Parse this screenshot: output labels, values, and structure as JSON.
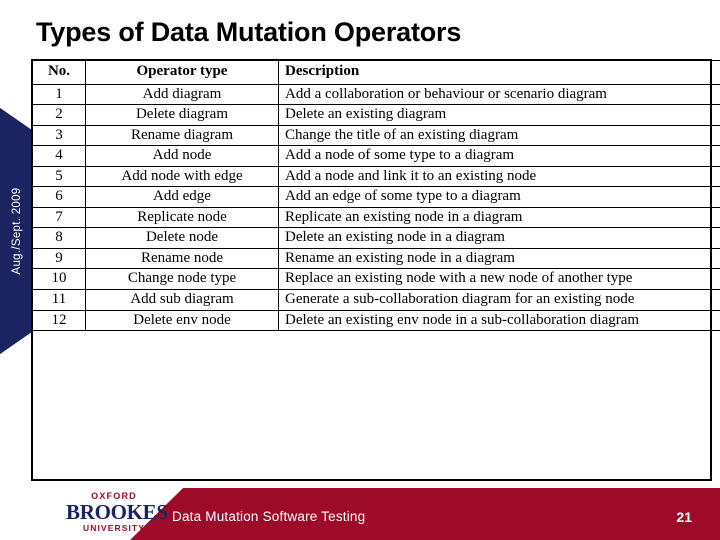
{
  "slide": {
    "title": "Types of Data Mutation Operators",
    "side_tab_label": "Aug./Sept. 2009",
    "number": "21"
  },
  "table": {
    "headers": {
      "no": "No.",
      "operator_type": "Operator type",
      "description": "Description"
    },
    "rows": [
      {
        "no": "1",
        "type": "Add diagram",
        "desc": "Add a collaboration or behaviour or scenario diagram"
      },
      {
        "no": "2",
        "type": "Delete diagram",
        "desc": "Delete an existing diagram"
      },
      {
        "no": "3",
        "type": "Rename diagram",
        "desc": "Change the title of an existing diagram"
      },
      {
        "no": "4",
        "type": "Add node",
        "desc": "Add a node of some type to a diagram"
      },
      {
        "no": "5",
        "type": "Add node with edge",
        "desc": "Add a node and link it to an existing node"
      },
      {
        "no": "6",
        "type": "Add edge",
        "desc": "Add an edge of some type to a diagram"
      },
      {
        "no": "7",
        "type": "Replicate node",
        "desc": "Replicate an existing node in a diagram"
      },
      {
        "no": "8",
        "type": "Delete node",
        "desc": "Delete an existing node in a diagram"
      },
      {
        "no": "9",
        "type": "Rename node",
        "desc": "Rename an existing node in a diagram"
      },
      {
        "no": "10",
        "type": "Change node type",
        "desc": "Replace an existing node with a new node of another type"
      },
      {
        "no": "11",
        "type": "Add sub diagram",
        "desc": "Generate a sub-collaboration diagram for an existing node"
      },
      {
        "no": "12",
        "type": "Delete env node",
        "desc": "Delete an existing env node in a sub-collaboration diagram"
      }
    ]
  },
  "footer": {
    "text": "Data Mutation Software Testing",
    "logo": {
      "oxford": "OXFORD",
      "brookes": "BROOKES",
      "university": "UNIVERSITY"
    }
  },
  "colors": {
    "navy": "#1b2461",
    "red": "#9e0b28",
    "text": "#000000",
    "background": "#ffffff"
  }
}
